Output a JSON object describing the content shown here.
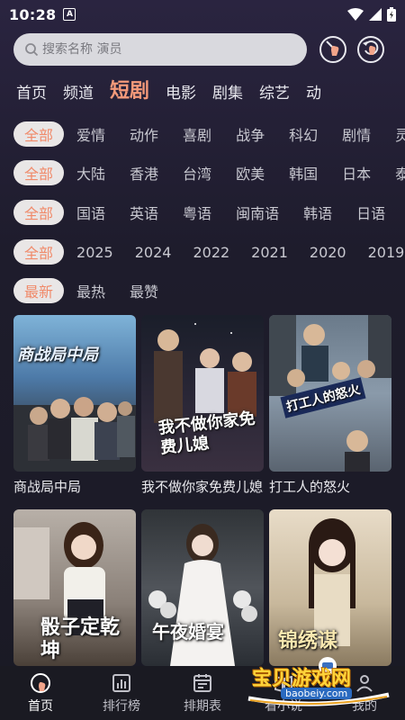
{
  "status": {
    "time": "10:28",
    "sim_label": "A"
  },
  "search": {
    "placeholder": "搜索名称 演员"
  },
  "tabs": [
    "首页",
    "频道",
    "短剧",
    "电影",
    "剧集",
    "综艺",
    "动"
  ],
  "active_tab_index": 2,
  "filters": {
    "genre": {
      "chip": "全部",
      "items": [
        "爱情",
        "动作",
        "喜剧",
        "战争",
        "科幻",
        "剧情",
        "灵"
      ]
    },
    "region": {
      "chip": "全部",
      "items": [
        "大陆",
        "香港",
        "台湾",
        "欧美",
        "韩国",
        "日本",
        "泰"
      ]
    },
    "language": {
      "chip": "全部",
      "items": [
        "国语",
        "英语",
        "粤语",
        "闽南语",
        "韩语",
        "日语"
      ]
    },
    "year": {
      "chip": "全部",
      "items": [
        "2025",
        "2024",
        "2022",
        "2021",
        "2020",
        "2019"
      ]
    },
    "sort": {
      "chip": "最新",
      "items": [
        "最热",
        "最赞"
      ]
    }
  },
  "cards": [
    {
      "title": "商战局中局",
      "poster_text": "商战局中局"
    },
    {
      "title": "我不做你家免费儿媳",
      "poster_text": "我不做你家免费儿媳"
    },
    {
      "title": "打工人的怒火",
      "poster_text": "打工人的怒火"
    },
    {
      "title": "",
      "poster_text": "骰子定乾坤"
    },
    {
      "title": "",
      "poster_text": "午夜婚宴"
    },
    {
      "title": "",
      "poster_text": "锦绣谋"
    }
  ],
  "bottom_nav": [
    "首页",
    "排行榜",
    "排期表",
    "看小说",
    "我的"
  ],
  "watermark": {
    "text": "宝贝游戏网",
    "url": "baobeiy.com"
  },
  "colors": {
    "accent": "#f59a7a",
    "chip_bg": "#e9e6e6",
    "bg": "#1e1c2c"
  }
}
